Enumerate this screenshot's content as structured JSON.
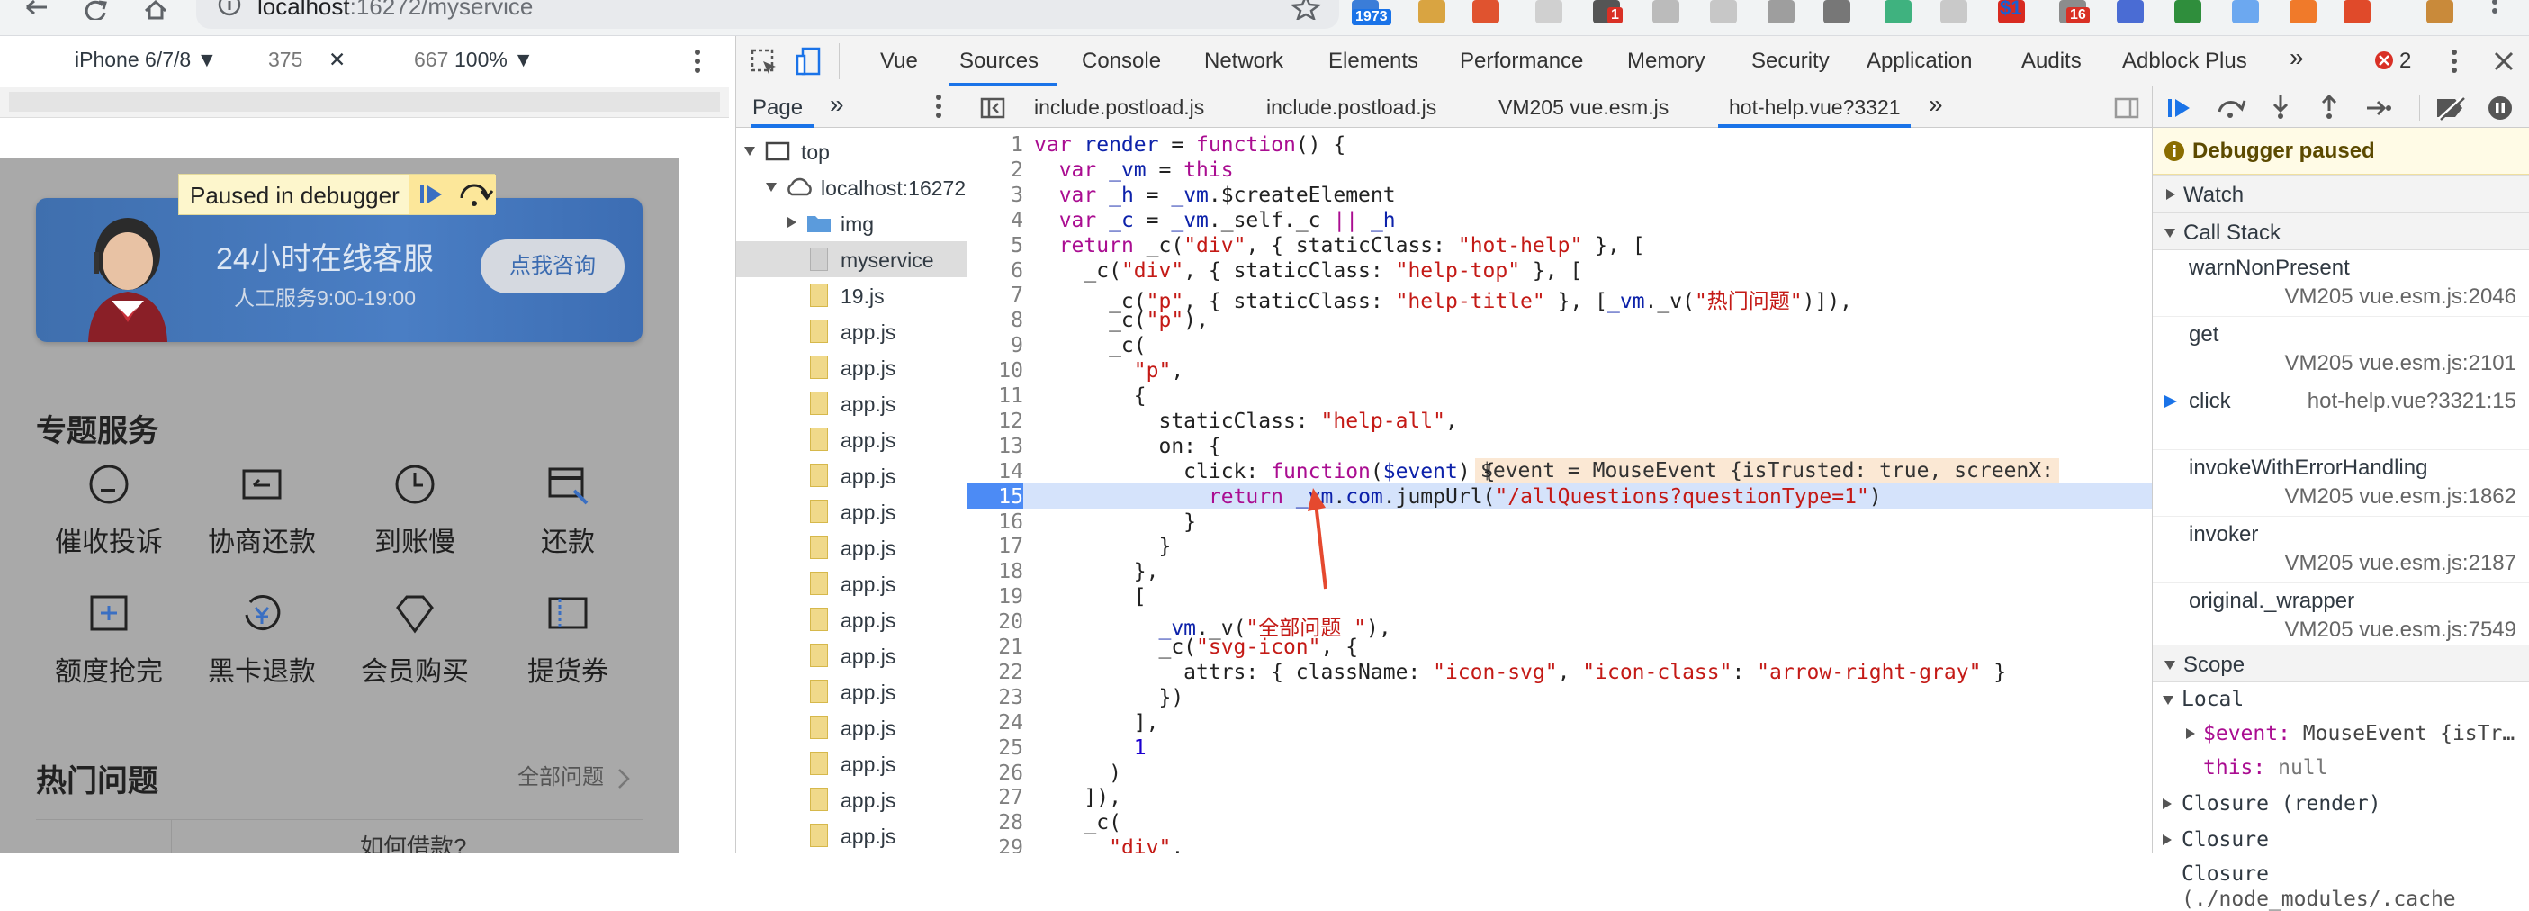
{
  "browser": {
    "url_host": "localhost",
    "url_rest": ":16272/myservice",
    "extension_badges": [
      "1973",
      "1",
      "$1",
      "16",
      "2"
    ]
  },
  "device_toolbar": {
    "device": "iPhone 6/7/8 ▼",
    "width": "375",
    "times": "✕",
    "height": "667",
    "zoom": "100% ▼"
  },
  "phone": {
    "paused_label": "Paused in debugger",
    "banner_title": "24小时在线客服",
    "banner_sub": "人工服务9:00-19:00",
    "banner_button": "点我咨询",
    "section_title": "专题服务",
    "services": [
      {
        "label": "催收投诉",
        "icon": "chat-bubble-icon"
      },
      {
        "label": "协商还款",
        "icon": "card-icon"
      },
      {
        "label": "到账慢",
        "icon": "clock-icon"
      },
      {
        "label": "还款",
        "icon": "repay-icon"
      },
      {
        "label": "额度抢完",
        "icon": "quota-icon"
      },
      {
        "label": "黑卡退款",
        "icon": "refund-icon"
      },
      {
        "label": "会员购买",
        "icon": "diamond-icon"
      },
      {
        "label": "提货券",
        "icon": "coupon-icon"
      }
    ],
    "hot_title": "热门问题",
    "hot_more": "全部问题",
    "bottom_question": "如何借款?"
  },
  "devtools": {
    "tabs": [
      "Vue",
      "Sources",
      "Console",
      "Network",
      "Elements",
      "Performance",
      "Memory",
      "Security",
      "Application",
      "Audits",
      "Adblock Plus"
    ],
    "active_tab": "Sources",
    "error_count": "2",
    "more": "»",
    "navigator": {
      "head": "Page",
      "more": "»",
      "tree": [
        {
          "label": "top"
        },
        {
          "label": "localhost:16272"
        },
        {
          "label": "img"
        },
        {
          "label": "myservice"
        },
        {
          "label": "19.js"
        },
        {
          "label": "app.js"
        },
        {
          "label": "app.js"
        },
        {
          "label": "app.js"
        },
        {
          "label": "app.js"
        },
        {
          "label": "app.js"
        },
        {
          "label": "app.js"
        },
        {
          "label": "app.js"
        },
        {
          "label": "app.js"
        },
        {
          "label": "app.js"
        },
        {
          "label": "app.js"
        },
        {
          "label": "app.js"
        },
        {
          "label": "app.js"
        },
        {
          "label": "app.js"
        },
        {
          "label": "app.js"
        },
        {
          "label": "app.js"
        }
      ]
    },
    "editor_tabs": [
      "include.postload.js",
      "include.postload.js",
      "VM205 vue.esm.js",
      "hot-help.vue?3321"
    ],
    "active_editor_tab": "hot-help.vue?3321",
    "event_preview": "$event = MouseEvent {isTrusted: true, screenX:",
    "current_line": 15,
    "debugger": {
      "paused": "Debugger paused",
      "watch": "Watch",
      "call_stack": "Call Stack",
      "frames": [
        {
          "fn": "warnNonPresent",
          "loc": "VM205 vue.esm.js:2046"
        },
        {
          "fn": "get",
          "loc": "VM205 vue.esm.js:2101"
        },
        {
          "fn": "click",
          "loc": "hot-help.vue?3321:15"
        },
        {
          "fn": "invokeWithErrorHandling",
          "loc": "VM205 vue.esm.js:1862"
        },
        {
          "fn": "invoker",
          "loc": "VM205 vue.esm.js:2187"
        },
        {
          "fn": "original._wrapper",
          "loc": "VM205 vue.esm.js:7549"
        }
      ],
      "scope": "Scope",
      "local": "Local",
      "event_key": "$event:",
      "event_val": " MouseEvent {isTr…",
      "this_key": "this:",
      "this_val": " null",
      "closure_render": "Closure (render)",
      "closure": "Closure",
      "closure2": "Closure",
      "closure2_sub": "(./node_modules/.cache"
    }
  }
}
